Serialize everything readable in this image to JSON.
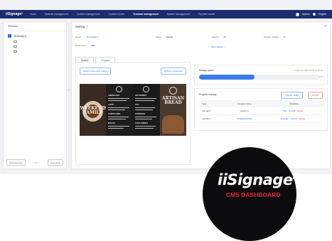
{
  "nav": {
    "logo": "iiSignage²",
    "items": [
      "Home",
      "Material management",
      "Content management",
      "Content review",
      "Terminal management",
      "System Management",
      "Payment center"
    ],
    "active_index": 4,
    "user": "System",
    "language": "English"
  },
  "sidebar": {
    "title": "Terminal",
    "root_label": "Terminal(01)",
    "footer_left": "Terminal group",
    "footer_mid": "0/1",
    "footer_right": "Send group"
  },
  "detail": {
    "title": "Setting ⓘ",
    "name_label": "Name:",
    "name_value": "Terminal01 ✎",
    "mode_label": "Mode:",
    "mode_value": "Weekly",
    "volume_label": "Volume:",
    "volume_value": "20",
    "direction_label": "Screen rotation:",
    "direction_value": "0°",
    "brightness_label": "Brightness:",
    "brightness_value": "75%",
    "more_link": "More details ⌄"
  },
  "tabs": [
    "Gallery",
    "Program"
  ],
  "tabs_active": 1,
  "buttons": {
    "left": "Switch screenshot photos",
    "right": "Refresh screenshot"
  },
  "menu_image": {
    "left_text": "WEEKEND FAMILY",
    "right_text": "ARTISAN BREAD",
    "sections": [
      "AMERICANO",
      "LATTE",
      "CAPPUCCINO",
      "MOCHA",
      "HOT DRINKS",
      "TEA",
      "EXPRESSO",
      "COLD DRINKS"
    ]
  },
  "storage": {
    "label": "Storage space",
    "date": "Data time:2021-03-08 14:35:02",
    "percent": 0.46,
    "percent_label": "54%"
  },
  "program": {
    "title": "Program manage",
    "btn_upload": "Upload media",
    "btn_empty": "Empty",
    "columns": [
      "Type",
      "Program name",
      "Operation"
    ],
    "rows": [
      {
        "type": "Standard",
        "name": "amazon1",
        "ops": [
          "Play",
          "Cancel",
          "Delete"
        ]
      },
      {
        "type": "Standard",
        "name": "ProMax\\Sample",
        "ops": [
          "Pre-play",
          "Cancel",
          "Delete"
        ]
      }
    ]
  },
  "badge": {
    "brand": "iiSignage",
    "sup": "2",
    "subtitle": "CMS DASHBOARD"
  }
}
